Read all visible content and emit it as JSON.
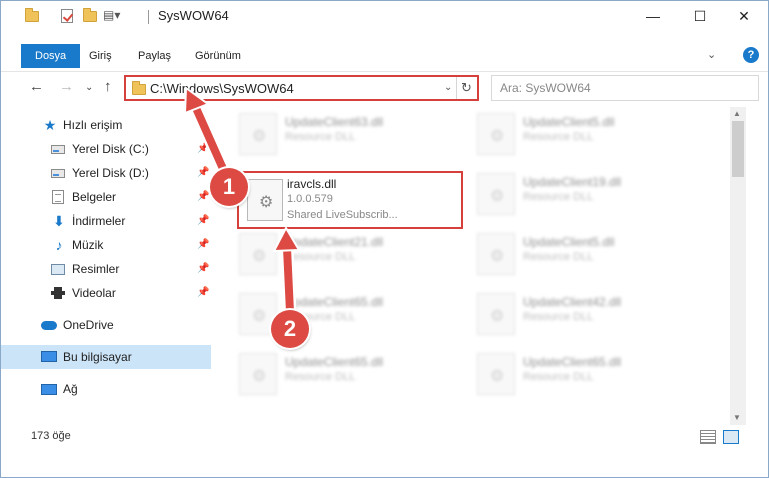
{
  "titlebar": {
    "title": "SysWOW64",
    "minimize": "—",
    "maximize": "☐",
    "close": "✕"
  },
  "ribbon": {
    "tabs": [
      "Dosya",
      "Giriş",
      "Paylaş",
      "Görünüm"
    ],
    "expand": "⌄",
    "help": "?"
  },
  "nav": {
    "back": "←",
    "forward": "→",
    "recent": "⌄",
    "up": "↑"
  },
  "address": {
    "path": "C:\\Windows\\SysWOW64",
    "dropdown": "⌄",
    "refresh": "↻"
  },
  "search": {
    "placeholder": "Ara: SysWOW64"
  },
  "sidebar": {
    "quick_access": "Hızlı erişim",
    "items": [
      {
        "label": "Yerel Disk (C:)",
        "icon": "drive-icon",
        "pinned": true
      },
      {
        "label": "Yerel Disk (D:)",
        "icon": "drive-icon",
        "pinned": true
      },
      {
        "label": "Belgeler",
        "icon": "documents-icon",
        "pinned": true
      },
      {
        "label": "İndirmeler",
        "icon": "download-icon",
        "pinned": true
      },
      {
        "label": "Müzik",
        "icon": "music-icon",
        "pinned": true
      },
      {
        "label": "Resimler",
        "icon": "pictures-icon",
        "pinned": true
      },
      {
        "label": "Videolar",
        "icon": "videos-icon",
        "pinned": true
      }
    ],
    "onedrive": "OneDrive",
    "this_pc": "Bu bilgisayar",
    "network": "Ağ",
    "pin_glyph": "📌"
  },
  "files": [
    {
      "name": "UpdateClient63.dll",
      "sub": "Resource DLL"
    },
    {
      "name": "UpdateClient5.dll",
      "sub": "Resource DLL"
    },
    {
      "name": "UpdateClient19.dll",
      "sub": "Resource DLL"
    },
    {
      "name": "UpdateClient21.dll",
      "sub": "Resource DLL"
    },
    {
      "name": "UpdateClient5.dll",
      "sub": "Resource DLL"
    },
    {
      "name": "UpdateClient65.dll",
      "sub": "Resource DLL"
    },
    {
      "name": "UpdateClient42.dll",
      "sub": "Resource DLL"
    },
    {
      "name": "UpdateClient65.dll",
      "sub": "Resource DLL"
    },
    {
      "name": "UpdateClient65.dll",
      "sub": "Resource DLL"
    }
  ],
  "featured_file": {
    "name": "iravcls.dll",
    "version": "1.0.0.579",
    "description": "Shared LiveSubscrib..."
  },
  "status": {
    "count": "173 öğe"
  },
  "callouts": {
    "one": "1",
    "two": "2"
  },
  "colors": {
    "accent": "#1979ca",
    "highlight": "#d6403c",
    "callout": "#dc4a43"
  }
}
